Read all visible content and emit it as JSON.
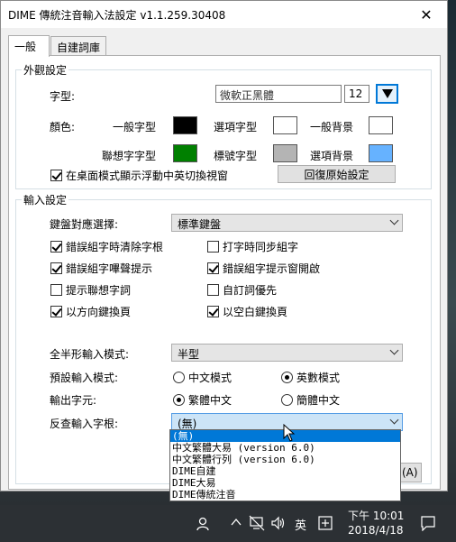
{
  "window": {
    "title": "DIME 傳統注音輸入法設定 v1.1.259.30408",
    "close_glyph": "✕"
  },
  "tabs": [
    {
      "label": "一般"
    },
    {
      "label": "自建詞庫"
    }
  ],
  "appearance": {
    "group_title": "外觀設定",
    "font_label": "字型:",
    "font_name": "微軟正黑體",
    "font_size": "12",
    "color_label": "顏色:",
    "colors": {
      "normal_char": {
        "label": "一般字型",
        "color": "#000000"
      },
      "option_char": {
        "label": "選項字型",
        "color": "#ffffff"
      },
      "normal_bg": {
        "label": "一般背景",
        "color": "#ffffff"
      },
      "assoc_char": {
        "label": "聯想字字型",
        "color": "#008000"
      },
      "mark_char": {
        "label": "標號字型",
        "color": "#b4b4b4"
      },
      "option_bg": {
        "label": "選項背景",
        "color": "#66b2ff"
      }
    },
    "floating_checkbox": "在桌面模式顯示浮動中英切換視窗",
    "restore_button": "回復原始設定"
  },
  "input": {
    "group_title": "輸入設定",
    "keyboard_label": "鍵盤對應選擇:",
    "keyboard_value": "標準鍵盤",
    "checks": [
      {
        "label": "錯誤組字時清除字根",
        "checked": true
      },
      {
        "label": "打字時同步組字",
        "checked": false
      },
      {
        "label": "錯誤組字嗶聲提示",
        "checked": true
      },
      {
        "label": "錯誤組字提示窗開啟",
        "checked": true
      },
      {
        "label": "提示聯想字詞",
        "checked": false
      },
      {
        "label": "自訂詞優先",
        "checked": false
      },
      {
        "label": "以方向鍵換頁",
        "checked": true
      },
      {
        "label": "以空白鍵換頁",
        "checked": true
      }
    ],
    "width_mode_label": "全半形輸入模式:",
    "width_mode_value": "半型",
    "default_mode_label": "預設輸入模式:",
    "default_mode_options": [
      {
        "label": "中文模式",
        "selected": false
      },
      {
        "label": "英數模式",
        "selected": true
      }
    ],
    "output_label": "輸出字元:",
    "output_options": [
      {
        "label": "繁體中文",
        "selected": true
      },
      {
        "label": "簡體中文",
        "selected": false
      }
    ],
    "reverse_label": "反查輸入字根:",
    "reverse_value": "(無)",
    "reverse_options": [
      "(無)",
      "中文繁體大易 (version 6.0)",
      "中文繁體行列 (version 6.0)",
      "DIME自建",
      "DIME大易",
      "DIME傳統注音"
    ]
  },
  "partial_button": "(A)",
  "taskbar": {
    "ime_indicator": "英",
    "time": "下午 10:01",
    "date": "2018/4/18"
  }
}
